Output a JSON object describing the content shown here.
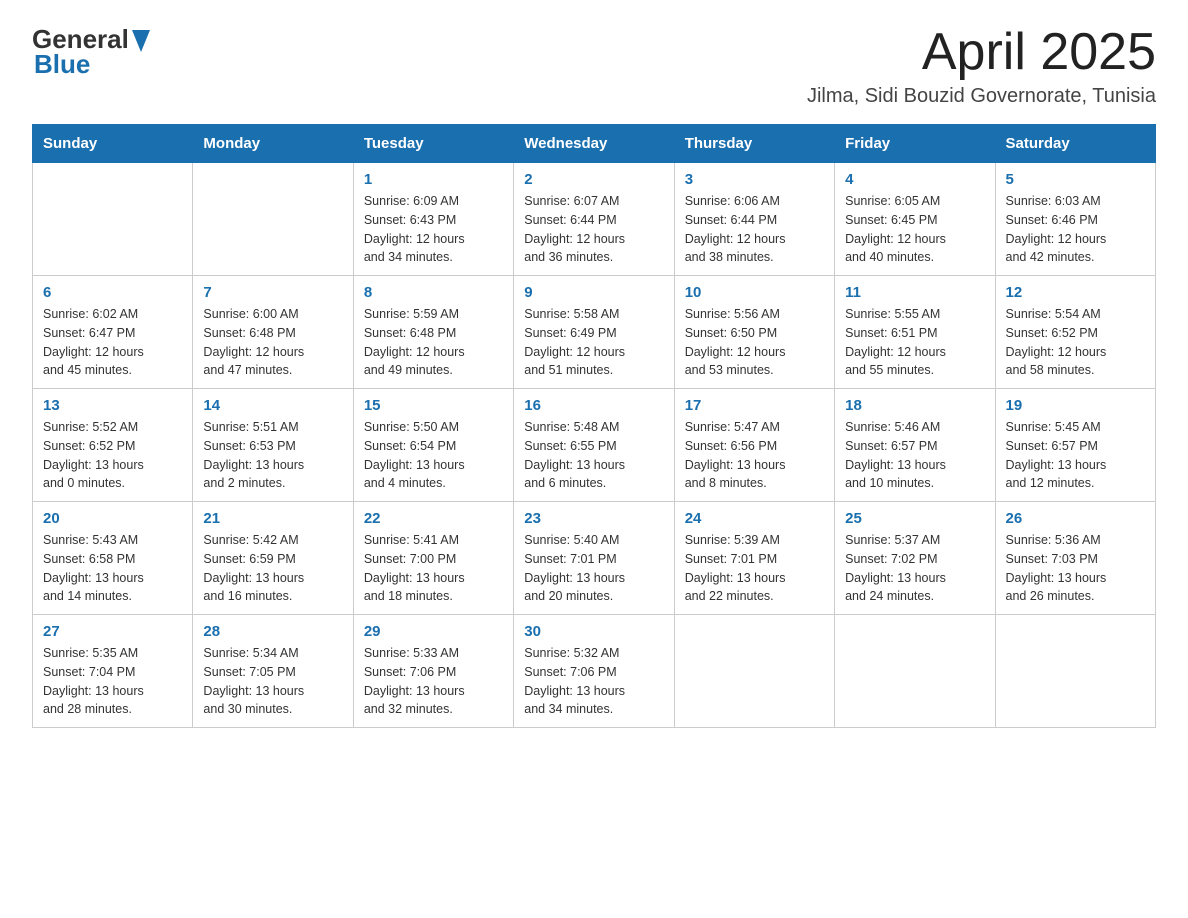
{
  "header": {
    "logo_general": "General",
    "logo_blue": "Blue",
    "title": "April 2025",
    "subtitle": "Jilma, Sidi Bouzid Governorate, Tunisia"
  },
  "days_of_week": [
    "Sunday",
    "Monday",
    "Tuesday",
    "Wednesday",
    "Thursday",
    "Friday",
    "Saturday"
  ],
  "weeks": [
    [
      {
        "day": "",
        "info": ""
      },
      {
        "day": "",
        "info": ""
      },
      {
        "day": "1",
        "info": "Sunrise: 6:09 AM\nSunset: 6:43 PM\nDaylight: 12 hours\nand 34 minutes."
      },
      {
        "day": "2",
        "info": "Sunrise: 6:07 AM\nSunset: 6:44 PM\nDaylight: 12 hours\nand 36 minutes."
      },
      {
        "day": "3",
        "info": "Sunrise: 6:06 AM\nSunset: 6:44 PM\nDaylight: 12 hours\nand 38 minutes."
      },
      {
        "day": "4",
        "info": "Sunrise: 6:05 AM\nSunset: 6:45 PM\nDaylight: 12 hours\nand 40 minutes."
      },
      {
        "day": "5",
        "info": "Sunrise: 6:03 AM\nSunset: 6:46 PM\nDaylight: 12 hours\nand 42 minutes."
      }
    ],
    [
      {
        "day": "6",
        "info": "Sunrise: 6:02 AM\nSunset: 6:47 PM\nDaylight: 12 hours\nand 45 minutes."
      },
      {
        "day": "7",
        "info": "Sunrise: 6:00 AM\nSunset: 6:48 PM\nDaylight: 12 hours\nand 47 minutes."
      },
      {
        "day": "8",
        "info": "Sunrise: 5:59 AM\nSunset: 6:48 PM\nDaylight: 12 hours\nand 49 minutes."
      },
      {
        "day": "9",
        "info": "Sunrise: 5:58 AM\nSunset: 6:49 PM\nDaylight: 12 hours\nand 51 minutes."
      },
      {
        "day": "10",
        "info": "Sunrise: 5:56 AM\nSunset: 6:50 PM\nDaylight: 12 hours\nand 53 minutes."
      },
      {
        "day": "11",
        "info": "Sunrise: 5:55 AM\nSunset: 6:51 PM\nDaylight: 12 hours\nand 55 minutes."
      },
      {
        "day": "12",
        "info": "Sunrise: 5:54 AM\nSunset: 6:52 PM\nDaylight: 12 hours\nand 58 minutes."
      }
    ],
    [
      {
        "day": "13",
        "info": "Sunrise: 5:52 AM\nSunset: 6:52 PM\nDaylight: 13 hours\nand 0 minutes."
      },
      {
        "day": "14",
        "info": "Sunrise: 5:51 AM\nSunset: 6:53 PM\nDaylight: 13 hours\nand 2 minutes."
      },
      {
        "day": "15",
        "info": "Sunrise: 5:50 AM\nSunset: 6:54 PM\nDaylight: 13 hours\nand 4 minutes."
      },
      {
        "day": "16",
        "info": "Sunrise: 5:48 AM\nSunset: 6:55 PM\nDaylight: 13 hours\nand 6 minutes."
      },
      {
        "day": "17",
        "info": "Sunrise: 5:47 AM\nSunset: 6:56 PM\nDaylight: 13 hours\nand 8 minutes."
      },
      {
        "day": "18",
        "info": "Sunrise: 5:46 AM\nSunset: 6:57 PM\nDaylight: 13 hours\nand 10 minutes."
      },
      {
        "day": "19",
        "info": "Sunrise: 5:45 AM\nSunset: 6:57 PM\nDaylight: 13 hours\nand 12 minutes."
      }
    ],
    [
      {
        "day": "20",
        "info": "Sunrise: 5:43 AM\nSunset: 6:58 PM\nDaylight: 13 hours\nand 14 minutes."
      },
      {
        "day": "21",
        "info": "Sunrise: 5:42 AM\nSunset: 6:59 PM\nDaylight: 13 hours\nand 16 minutes."
      },
      {
        "day": "22",
        "info": "Sunrise: 5:41 AM\nSunset: 7:00 PM\nDaylight: 13 hours\nand 18 minutes."
      },
      {
        "day": "23",
        "info": "Sunrise: 5:40 AM\nSunset: 7:01 PM\nDaylight: 13 hours\nand 20 minutes."
      },
      {
        "day": "24",
        "info": "Sunrise: 5:39 AM\nSunset: 7:01 PM\nDaylight: 13 hours\nand 22 minutes."
      },
      {
        "day": "25",
        "info": "Sunrise: 5:37 AM\nSunset: 7:02 PM\nDaylight: 13 hours\nand 24 minutes."
      },
      {
        "day": "26",
        "info": "Sunrise: 5:36 AM\nSunset: 7:03 PM\nDaylight: 13 hours\nand 26 minutes."
      }
    ],
    [
      {
        "day": "27",
        "info": "Sunrise: 5:35 AM\nSunset: 7:04 PM\nDaylight: 13 hours\nand 28 minutes."
      },
      {
        "day": "28",
        "info": "Sunrise: 5:34 AM\nSunset: 7:05 PM\nDaylight: 13 hours\nand 30 minutes."
      },
      {
        "day": "29",
        "info": "Sunrise: 5:33 AM\nSunset: 7:06 PM\nDaylight: 13 hours\nand 32 minutes."
      },
      {
        "day": "30",
        "info": "Sunrise: 5:32 AM\nSunset: 7:06 PM\nDaylight: 13 hours\nand 34 minutes."
      },
      {
        "day": "",
        "info": ""
      },
      {
        "day": "",
        "info": ""
      },
      {
        "day": "",
        "info": ""
      }
    ]
  ]
}
